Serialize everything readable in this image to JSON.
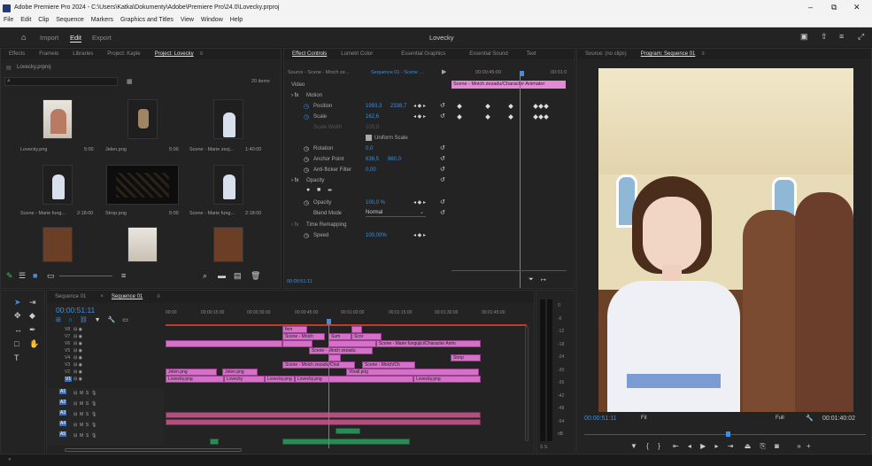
{
  "app": {
    "title": "Adobe Premiere Pro 2024 - C:\\Users\\Katka\\Dokumenty\\Adobe\\Premiere Pro\\24.0\\Lovecky.prproj",
    "menu": [
      "File",
      "Edit",
      "Clip",
      "Sequence",
      "Markers",
      "Graphics and Titles",
      "View",
      "Window",
      "Help"
    ],
    "workspaces": [
      "Import",
      "Edit",
      "Export"
    ],
    "project_name": "Lovecky"
  },
  "left_tabs": [
    "Effects",
    "Frameio",
    "Libraries",
    "Project: Kaple",
    "Project: Lovecky"
  ],
  "project": {
    "file": "Lovecky.prproj",
    "item_count": "20 items",
    "items": [
      {
        "name": "Lovecky.png",
        "dur": "5:00"
      },
      {
        "name": "Jelen.png",
        "dur": "5:00"
      },
      {
        "name": "Scene - Marie zezj...",
        "dur": "1:40:00"
      },
      {
        "name": "Scene - Marie fung...",
        "dur": "2:18:00"
      },
      {
        "name": "Strop.png",
        "dur": "5:00"
      },
      {
        "name": "Scene - Marie fung...",
        "dur": "2:18:00"
      }
    ]
  },
  "effect_tabs": [
    "Effect Controls",
    "Lumetri Color",
    "Essential Graphics",
    "Essential Sound",
    "Text"
  ],
  "effect_controls": {
    "source": "Source - Scene - Mnich ze...",
    "sequence": "Sequence 01 - Scene ...",
    "time_marker": "00:00:45:00",
    "time_end": "00:01:0",
    "clip_label": "Scene - Mnich zezadu/Character Animator",
    "section_video": "Video",
    "rows": [
      {
        "name": "Motion",
        "fx": true
      },
      {
        "name": "Position",
        "v1": "1993,3",
        "v2": "2338,7"
      },
      {
        "name": "Scale",
        "v1": "162,6"
      },
      {
        "name": "Scale Width",
        "v1": "100,0"
      },
      {
        "name": "Uniform Scale"
      },
      {
        "name": "Rotation",
        "v1": "0,0"
      },
      {
        "name": "Anchor Point",
        "v1": "638,5",
        "v2": "960,0"
      },
      {
        "name": "Anti-flicker Filter",
        "v1": "0,00"
      },
      {
        "name": "Opacity",
        "fx": true
      },
      {
        "name": "Opacity",
        "v1": "100,0 %"
      },
      {
        "name": "Blend Mode",
        "v1": "Normal"
      },
      {
        "name": "Time Remapping",
        "fx": true
      },
      {
        "name": "Speed",
        "v1": "100,00%"
      }
    ],
    "timecode": "00:00:51:11"
  },
  "program": {
    "tabs": [
      "Source: (no clips)",
      "Program: Sequence 01"
    ],
    "timecode": "00:00:51:11",
    "fit": "Fit",
    "full": "Full",
    "duration": "00:01:40:02"
  },
  "timeline": {
    "tabs": [
      "Sequence 01",
      "Sequence 01"
    ],
    "timecode": "00:00:51:11",
    "ruler": [
      "00:00",
      "00:00:15:00",
      "00:00:30:00",
      "00:00:45:00",
      "00:01:00:00",
      "00:01:15:00",
      "00:01:30:00",
      "00:01:45:00"
    ],
    "video_tracks": [
      "V8",
      "V7",
      "V6",
      "V5",
      "V4",
      "V3",
      "V2",
      "V1"
    ],
    "audio_tracks": [
      "A1",
      "A2",
      "A3",
      "A4",
      "A5"
    ],
    "clips": [
      "fem",
      "Scene - Mnich",
      "Sum",
      "Scor",
      "Scene - Marie fungujici/Character Anim",
      "Scene - Mnich zezadu",
      "Strop",
      "Scene - Mnich zezadu/Chai",
      "Scene - Mnich/Ch",
      "Jelen.png",
      "Jelen.png",
      "Vlnall.png",
      "Lovecky.png",
      "Lovecky",
      "Lovecky.png",
      "Lovecky.png",
      "Lovecky.png"
    ]
  },
  "meter_scale": [
    "0",
    "-6",
    "-12",
    "-18",
    "-24",
    "-30",
    "-36",
    "-42",
    "-48",
    "-54",
    "dB"
  ]
}
